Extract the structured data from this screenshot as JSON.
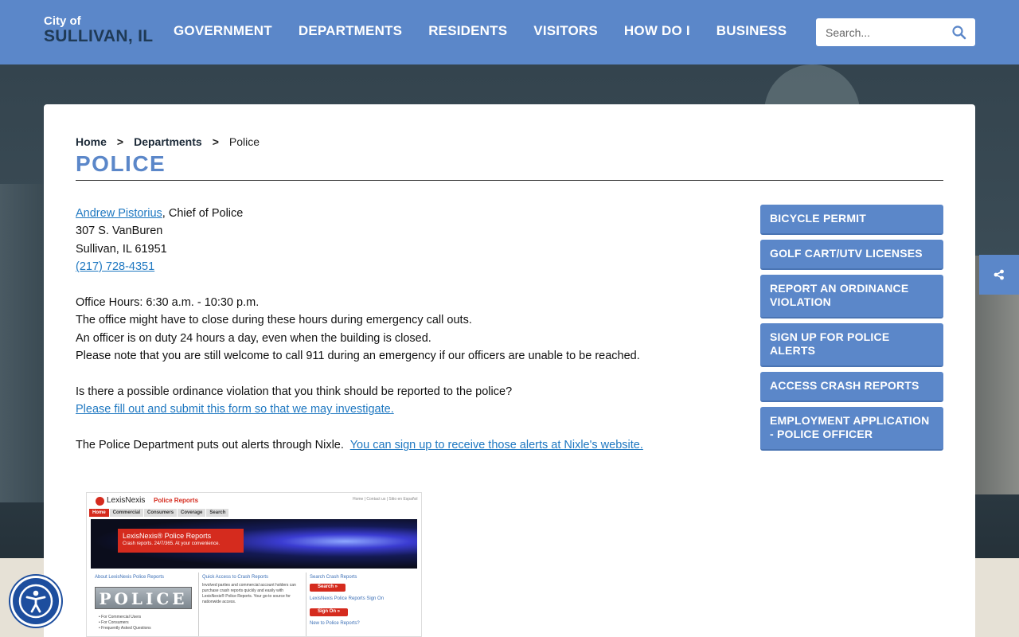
{
  "header": {
    "logo_small": "City of",
    "logo_big": "SULLIVAN, IL",
    "nav": [
      "GOVERNMENT",
      "DEPARTMENTS",
      "RESIDENTS",
      "VISITORS",
      "HOW DO I",
      "BUSINESS"
    ],
    "search_placeholder": "Search..."
  },
  "breadcrumb": {
    "home": "Home",
    "sep": ">",
    "departments": "Departments",
    "current": "Police"
  },
  "page_title": "POLICE",
  "contact": {
    "chief_name": "Andrew Pistorius",
    "chief_title": ", Chief of Police",
    "address1": "307 S. VanBuren",
    "address2": "Sullivan, IL 61951",
    "phone": "(217) 728-4351"
  },
  "hours": {
    "line1": "Office Hours:  6:30 a.m. - 10:30 p.m.",
    "line2": "The office might have to close during these hours during emergency call outs.",
    "line3": "An officer is on duty 24 hours a day, even when the building is closed.",
    "line4": "Please note that you are still welcome to call 911 during an emergency if our officers are unable to be reached."
  },
  "ordinance": {
    "question": "Is there a possible ordinance violation that you think should be reported to the police?",
    "link": "Please fill out and submit this form so that we may investigate."
  },
  "nixle": {
    "text": "The Police Department puts out alerts through Nixle.",
    "link": "You can sign up to receive those alerts at Nixle's website."
  },
  "sidebar": {
    "buttons": [
      "BICYCLE PERMIT",
      "GOLF CART/UTV LICENSES",
      "REPORT AN ORDINANCE VIOLATION",
      "SIGN UP FOR POLICE ALERTS",
      "ACCESS CRASH REPORTS",
      "EMPLOYMENT APPLICATION - POLICE OFFICER"
    ]
  },
  "lexis": {
    "logo": "LexisNexis",
    "brand": "Police Reports",
    "toplinks": "Home | Contact us | Sitio en Español",
    "tabs": [
      "Home",
      "Commercial",
      "Consumers",
      "Coverage",
      "Search"
    ],
    "banner_title": "LexisNexis® Police Reports",
    "banner_sub": "Crash reports. 24/7/365. At your convenience.",
    "col1_title": "About LexisNexis Police Reports",
    "police_sign": "POLICE",
    "col1_links": "• For Commercial Users\n• For Consumers\n• Frequently Asked Questions",
    "col2_title": "Quick Access to Crash Reports",
    "col2_text": "Involved parties and commercial account holders can purchase crash reports quickly and easily with LexisNexis® Police Reports. Your go-to source for nationwide access.",
    "col3_title": "Search Crash Reports",
    "search_btn": "Search »",
    "signin_title": "LexisNexis Police Reports Sign On",
    "signin_btn": "Sign On »",
    "new_title": "New to Police Reports?"
  },
  "colors": {
    "brand_blue": "#5b87c9",
    "link_blue": "#1f78c1",
    "logo_dark": "#1f3a56"
  },
  "icons": {
    "search": "search-icon",
    "share": "share-icon",
    "accessibility": "accessibility-icon"
  }
}
